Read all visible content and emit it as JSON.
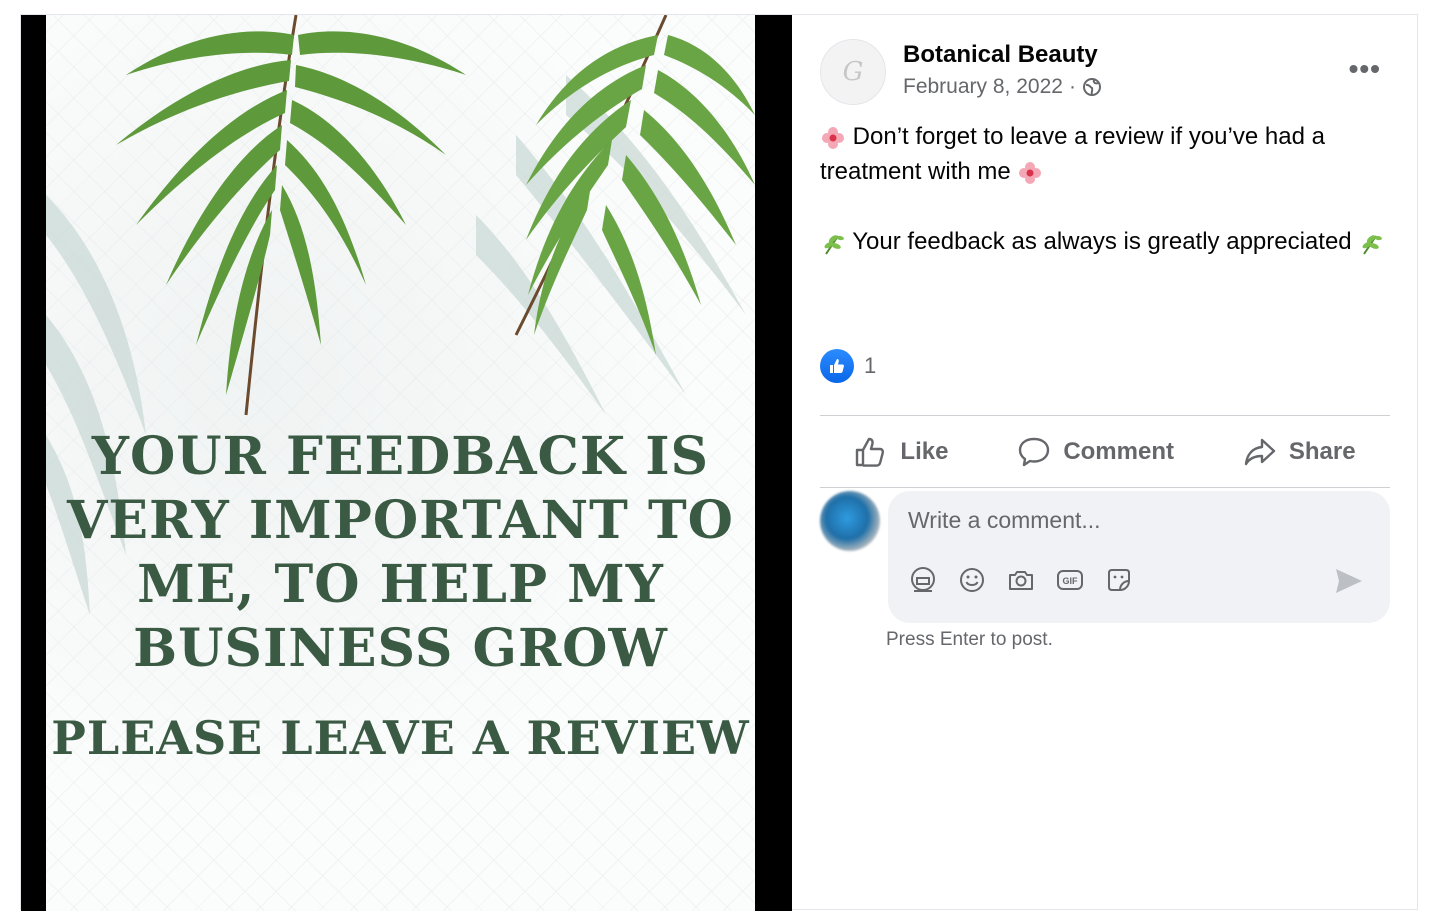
{
  "poster": {
    "headline": "YOUR FEEDBACK IS VERY IMPORTANT TO ME, TO HELP MY BUSINESS GROW",
    "cta": "PLEASE LEAVE A REVIEW"
  },
  "post": {
    "author": "Botanical Beauty",
    "date": "February 8, 2022",
    "separator": "·",
    "paragraphs": [
      "Don’t forget to leave a review if you’ve had a treatment with me",
      "Your feedback as always is greatly appreciated"
    ],
    "reaction_count": "1"
  },
  "actions": {
    "like": "Like",
    "comment": "Comment",
    "share": "Share"
  },
  "composer": {
    "placeholder": "Write a comment...",
    "hint": "Press Enter to post.",
    "gif_label": "GIF"
  },
  "colors": {
    "accent": "#1877f2",
    "secondary_text": "#65676b",
    "poster_text": "#3a5a44",
    "frond_green": "#5e9a3c"
  },
  "icons": [
    "more-options-icon",
    "globe-icon",
    "flower-emoji-icon",
    "herb-emoji-icon",
    "like-reaction-icon",
    "thumbs-up-icon",
    "comment-bubble-icon",
    "share-arrow-icon",
    "avatar-sticker-icon",
    "emoji-icon",
    "camera-icon",
    "gif-icon",
    "sticker-icon",
    "send-icon"
  ]
}
